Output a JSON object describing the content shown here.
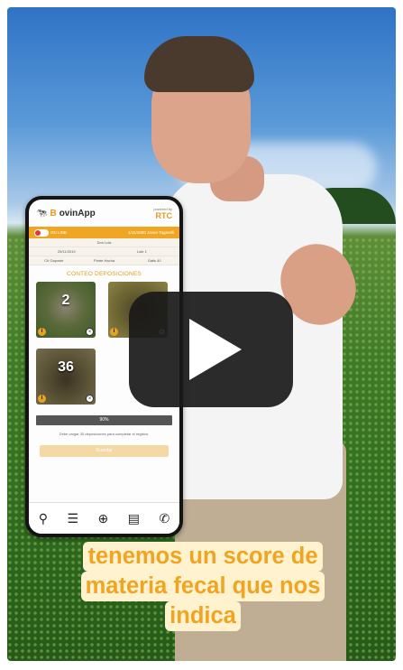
{
  "video": {
    "caption_lines": [
      "tenemos un score de",
      "materia fecal que nos",
      "indica"
    ],
    "play_icon": "play-icon"
  },
  "app": {
    "logo_text_b": "B",
    "logo_text_rest": "ovinApp",
    "powered_by": "powered by",
    "partner_logo": "RTC",
    "status_left": "ON LINE",
    "status_right": "1/11/1800 Javier Tagarelli",
    "info_rows": [
      [
        "Don Luis"
      ],
      [
        "29/11/2019",
        "Lote 1"
      ],
      [
        "Ch Gaposte",
        "Ponte Hacha",
        "Gatis 40"
      ]
    ],
    "section_title": "CONTEO DEPOSICIONES",
    "tiles": [
      {
        "number": "2"
      },
      {
        "number": ""
      },
      {
        "number": "36"
      }
    ],
    "progress_label": "90%",
    "hint": "Debe cargar 30 deposiciones para completar el registro.",
    "save_label": "Guardar",
    "nav_icons": [
      "user-icon",
      "list-icon",
      "add-circle-icon",
      "document-icon",
      "whatsapp-icon"
    ]
  }
}
